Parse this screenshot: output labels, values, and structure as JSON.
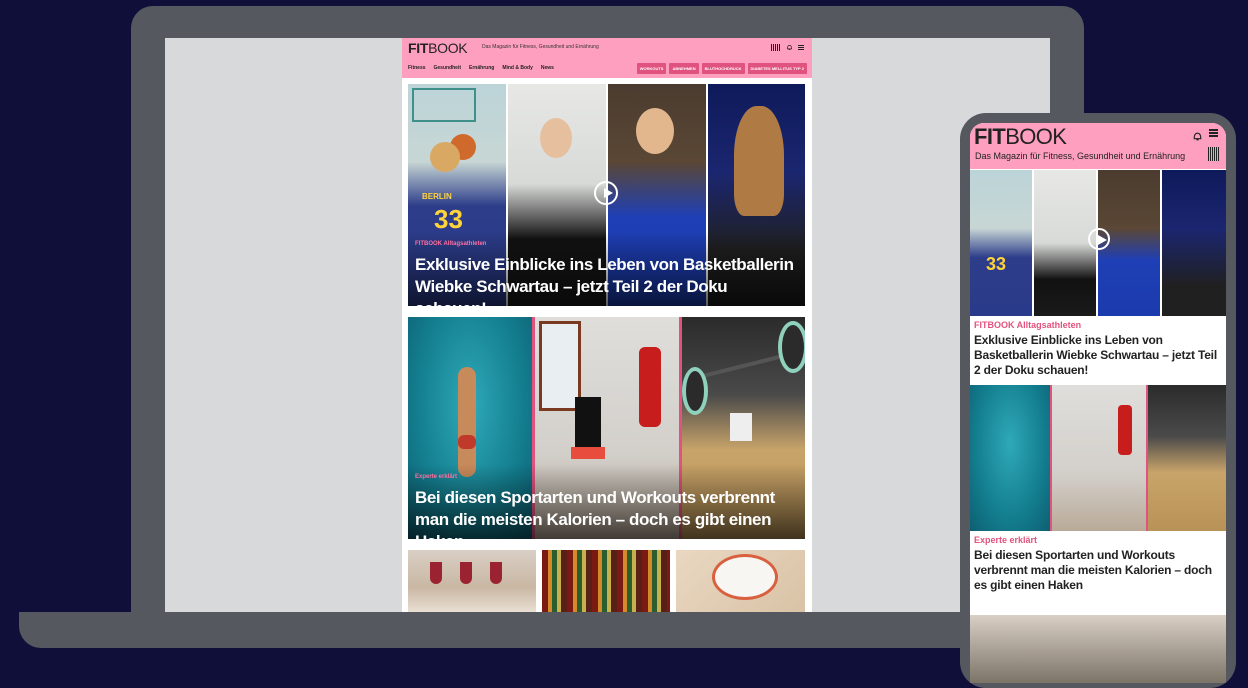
{
  "brand": {
    "logo_bold": "FIT",
    "logo_light": "BOOK",
    "tagline": "Das Magazin für Fitness, Gesundheit und Ernährung"
  },
  "nav": {
    "items": [
      "Fitness",
      "Gesundheit",
      "Ernährung",
      "Mind & Body",
      "News"
    ],
    "pills": [
      "WORKOUTS",
      "ABNEHMEN",
      "BLUTHOCHDRUCK",
      "DIABETES MELLITUS TYP 2"
    ]
  },
  "articles": [
    {
      "kicker": "FITBOOK Alltagsathleten",
      "headline": "Exklusive Einblicke ins Leben von Basketballerin Wiebke Schwartau – jetzt Teil 2 der Doku schauen!"
    },
    {
      "kicker": "Experte erklärt",
      "headline": "Bei diesen Sportarten und Workouts verbrennt man die meisten Kalorien – doch es gibt einen Haken"
    }
  ],
  "jersey": {
    "name": "BERLIN",
    "number": "33"
  },
  "colors": {
    "background": "#0f0f3a",
    "device_frame": "#55595f",
    "brand_pink": "#ff9fbf",
    "accent": "#e0537e"
  },
  "icons": [
    "bell-icon",
    "barcode-icon",
    "menu-icon",
    "play-icon"
  ]
}
